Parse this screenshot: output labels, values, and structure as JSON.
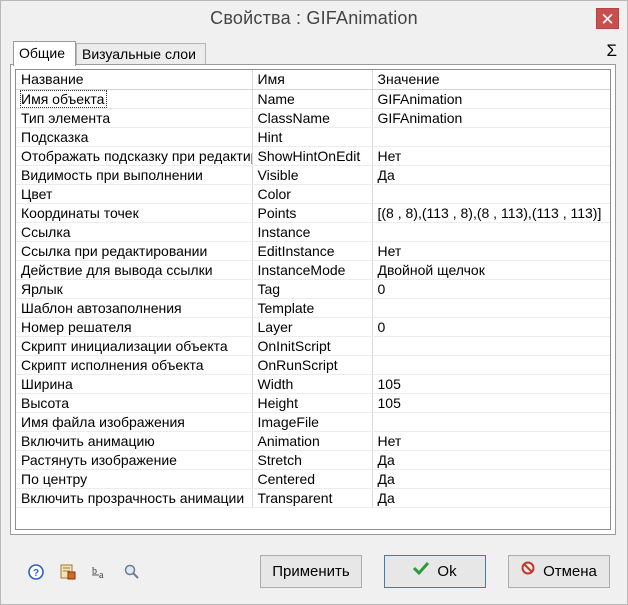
{
  "window": {
    "title": "Свойства :   GIFAnimation",
    "close_glyph": "✕"
  },
  "tabs": [
    {
      "label": "Общие",
      "active": true
    },
    {
      "label": "Визуальные слои",
      "active": false
    }
  ],
  "sigma_glyph": "Σ",
  "grid": {
    "headers": [
      "Название",
      "Имя",
      "Значение"
    ],
    "rows": [
      {
        "name": "Имя объекта",
        "key": "Name",
        "value": "GIFAnimation"
      },
      {
        "name": "Тип элемента",
        "key": "ClassName",
        "value": "GIFAnimation"
      },
      {
        "name": "Подсказка",
        "key": "Hint",
        "value": ""
      },
      {
        "name": "Отображать подсказку при редактировании",
        "key": "ShowHintOnEdit",
        "value": "Нет"
      },
      {
        "name": "Видимость при выполнении",
        "key": "Visible",
        "value": "Да"
      },
      {
        "name": "Цвет",
        "key": "Color",
        "value": ""
      },
      {
        "name": "Координаты точек",
        "key": "Points",
        "value": "[(8 , 8),(113 , 8),(8 , 113),(113 , 113)]"
      },
      {
        "name": "Ссылка",
        "key": "Instance",
        "value": ""
      },
      {
        "name": "Ссылка при редактировании",
        "key": "EditInstance",
        "value": "Нет"
      },
      {
        "name": "Действие для вывода ссылки",
        "key": "InstanceMode",
        "value": "Двойной щелчок"
      },
      {
        "name": "Ярлык",
        "key": "Tag",
        "value": "0"
      },
      {
        "name": "Шаблон автозаполнения",
        "key": "Template",
        "value": ""
      },
      {
        "name": "Номер решателя",
        "key": "Layer",
        "value": "0"
      },
      {
        "name": "Скрипт инициализации объекта",
        "key": "OnInitScript",
        "value": ""
      },
      {
        "name": "Скрипт исполнения объекта",
        "key": "OnRunScript",
        "value": ""
      },
      {
        "name": "Ширина",
        "key": "Width",
        "value": "105"
      },
      {
        "name": "Высота",
        "key": "Height",
        "value": "105"
      },
      {
        "name": "Имя файла изображения",
        "key": "ImageFile",
        "value": ""
      },
      {
        "name": "Включить анимацию",
        "key": "Animation",
        "value": "Нет"
      },
      {
        "name": "Растянуть изображение",
        "key": "Stretch",
        "value": "Да"
      },
      {
        "name": "По центру",
        "key": "Centered",
        "value": "Да"
      },
      {
        "name": "Включить прозрачность анимации",
        "key": "Transparent",
        "value": "Да"
      }
    ]
  },
  "footer_icons": [
    "help-icon",
    "properties-icon",
    "text-case-icon",
    "search-icon"
  ],
  "buttons": {
    "apply": "Применить",
    "ok": "Ok",
    "cancel": "Отмена"
  },
  "colors": {
    "close_bg": "#c7504e",
    "ok_check": "#2e9b3a",
    "cancel_icon": "#c0392b"
  }
}
